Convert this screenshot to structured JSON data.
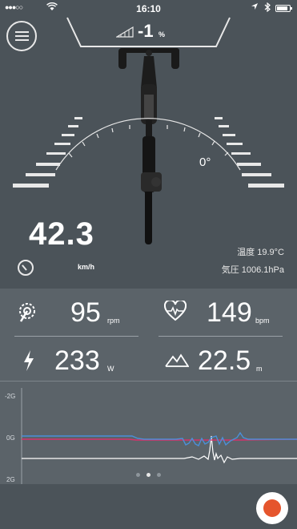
{
  "status_bar": {
    "signal": "●●●○○",
    "wifi_icon": "wifi-icon",
    "time": "16:10",
    "battery_level": 0.85
  },
  "header": {
    "grade_value": "-1",
    "grade_unit": "%"
  },
  "tilt": {
    "angle": "0°"
  },
  "speed": {
    "value": "42.3",
    "unit": "km/h"
  },
  "environment": {
    "temperature": "温度 19.9°C",
    "pressure": "気圧 1006.1hPa"
  },
  "stats": {
    "cadence": {
      "value": "95",
      "unit": "rpm"
    },
    "heart_rate": {
      "value": "149",
      "unit": "bpm"
    },
    "power": {
      "value": "233",
      "unit": "W"
    },
    "elevation": {
      "value": "22.5",
      "unit": "m"
    }
  },
  "graph": {
    "labels": [
      "-2G",
      "0G",
      "2G"
    ],
    "colors": {
      "blue": "#4a90d9",
      "red": "#d6336c",
      "white": "#ffffff"
    }
  },
  "pager": {
    "count": 3,
    "active": 1
  },
  "colors": {
    "background": "#4b5359",
    "panel": "#5b6369",
    "record": "#e5552d"
  }
}
